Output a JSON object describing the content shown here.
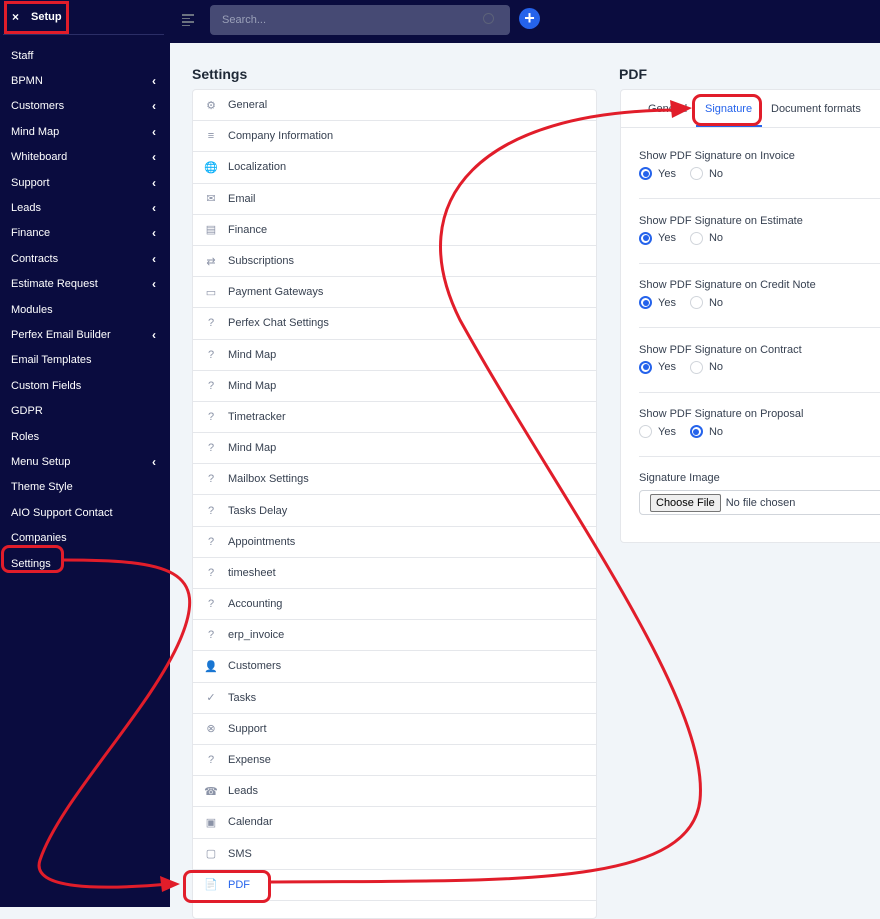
{
  "sidebar": {
    "header": {
      "close_icon": "×",
      "title": "Setup"
    },
    "items": [
      {
        "label": "Staff",
        "chevron": false
      },
      {
        "label": "BPMN",
        "chevron": true
      },
      {
        "label": "Customers",
        "chevron": true
      },
      {
        "label": "Mind Map",
        "chevron": true
      },
      {
        "label": "Whiteboard",
        "chevron": true
      },
      {
        "label": "Support",
        "chevron": true
      },
      {
        "label": "Leads",
        "chevron": true
      },
      {
        "label": "Finance",
        "chevron": true
      },
      {
        "label": "Contracts",
        "chevron": true
      },
      {
        "label": "Estimate Request",
        "chevron": true
      },
      {
        "label": "Modules",
        "chevron": false
      },
      {
        "label": "Perfex Email Builder",
        "chevron": true
      },
      {
        "label": "Email Templates",
        "chevron": false
      },
      {
        "label": "Custom Fields",
        "chevron": false
      },
      {
        "label": "GDPR",
        "chevron": false
      },
      {
        "label": "Roles",
        "chevron": false
      },
      {
        "label": "Menu Setup",
        "chevron": true
      },
      {
        "label": "Theme Style",
        "chevron": false
      },
      {
        "label": "AIO Support Contact",
        "chevron": false
      },
      {
        "label": "Companies",
        "chevron": false
      },
      {
        "label": "Settings",
        "chevron": false
      }
    ],
    "chevron_glyph": "‹"
  },
  "topbar": {
    "search_placeholder": "Search...",
    "add_glyph": "+"
  },
  "settings": {
    "title": "Settings",
    "items": [
      {
        "label": "General",
        "icon": "⚙"
      },
      {
        "label": "Company Information",
        "icon": "≡"
      },
      {
        "label": "Localization",
        "icon": "🌐"
      },
      {
        "label": "Email",
        "icon": "✉"
      },
      {
        "label": "Finance",
        "icon": "▤"
      },
      {
        "label": "Subscriptions",
        "icon": "⇄"
      },
      {
        "label": "Payment Gateways",
        "icon": "▭"
      },
      {
        "label": "Perfex Chat Settings",
        "icon": "?"
      },
      {
        "label": "Mind Map",
        "icon": "?"
      },
      {
        "label": "Mind Map",
        "icon": "?"
      },
      {
        "label": "Timetracker",
        "icon": "?"
      },
      {
        "label": "Mind Map",
        "icon": "?"
      },
      {
        "label": "Mailbox Settings",
        "icon": "?"
      },
      {
        "label": "Tasks Delay",
        "icon": "?"
      },
      {
        "label": "Appointments",
        "icon": "?"
      },
      {
        "label": "timesheet",
        "icon": "?"
      },
      {
        "label": "Accounting",
        "icon": "?"
      },
      {
        "label": "erp_invoice",
        "icon": "?"
      },
      {
        "label": "Customers",
        "icon": "👤"
      },
      {
        "label": "Tasks",
        "icon": "✓"
      },
      {
        "label": "Support",
        "icon": "⊗"
      },
      {
        "label": "Expense",
        "icon": "?"
      },
      {
        "label": "Leads",
        "icon": "☎"
      },
      {
        "label": "Calendar",
        "icon": "▣"
      },
      {
        "label": "SMS",
        "icon": "▢"
      },
      {
        "label": "PDF",
        "icon": "📄",
        "active": true
      }
    ]
  },
  "pdf": {
    "title": "PDF",
    "tabs": [
      {
        "label": "General"
      },
      {
        "label": "Signature",
        "active": true
      },
      {
        "label": "Document formats"
      }
    ],
    "options": [
      {
        "label": "Show PDF Signature on Invoice",
        "yes": "Yes",
        "no": "No",
        "value": "Yes"
      },
      {
        "label": "Show PDF Signature on Estimate",
        "yes": "Yes",
        "no": "No",
        "value": "Yes"
      },
      {
        "label": "Show PDF Signature on Credit Note",
        "yes": "Yes",
        "no": "No",
        "value": "Yes"
      },
      {
        "label": "Show PDF Signature on Contract",
        "yes": "Yes",
        "no": "No",
        "value": "Yes"
      },
      {
        "label": "Show PDF Signature on Proposal",
        "yes": "Yes",
        "no": "No",
        "value": "No"
      }
    ],
    "signature_image": {
      "label": "Signature Image",
      "button": "Choose File",
      "status": "No file chosen"
    }
  },
  "annotation_color": "#e11d2a"
}
